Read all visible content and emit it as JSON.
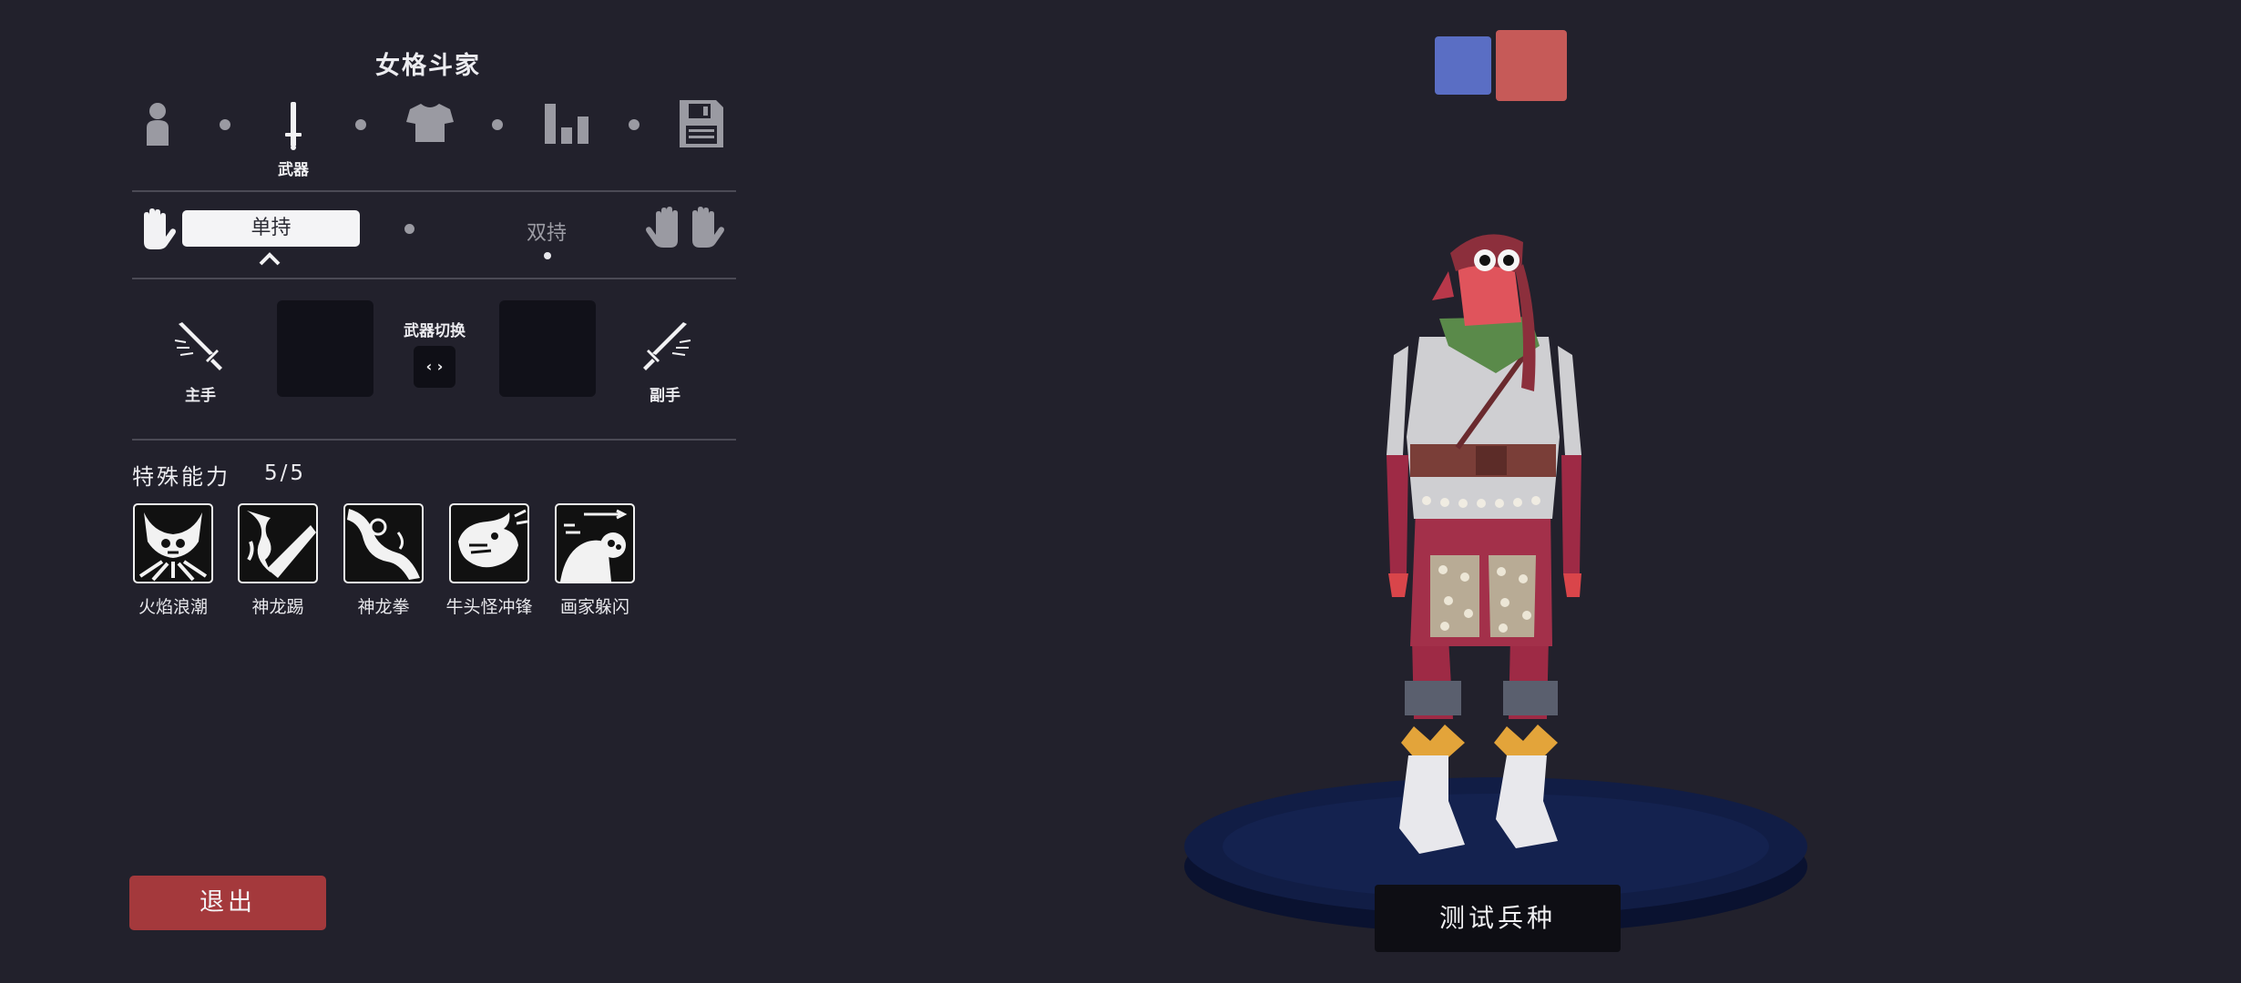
{
  "header": {
    "title": "女格斗家"
  },
  "steps": [
    {
      "name": "unit-base",
      "icon": "person-icon",
      "label": ""
    },
    {
      "name": "weapon",
      "icon": "sword-icon",
      "label": "武器"
    },
    {
      "name": "clothing",
      "icon": "shirt-icon",
      "label": ""
    },
    {
      "name": "stats",
      "icon": "bar-chart-icon",
      "label": ""
    },
    {
      "name": "save",
      "icon": "floppy-disk-icon",
      "label": ""
    }
  ],
  "grip": {
    "single": "单持",
    "dual": "双持",
    "selected": "单持"
  },
  "weapons": {
    "main_hand": "主手",
    "off_hand": "副手",
    "switch_label": "武器切换",
    "switch_glyph": "‹ ›"
  },
  "abilities": {
    "title": "特殊能力",
    "count": "5/5",
    "items": [
      {
        "label": "火焰浪潮",
        "icon": "fire-wave-icon"
      },
      {
        "label": "神龙踢",
        "icon": "dragon-kick-icon"
      },
      {
        "label": "神龙拳",
        "icon": "dragon-punch-icon"
      },
      {
        "label": "牛头怪冲锋",
        "icon": "minotaur-charge-icon"
      },
      {
        "label": "画家躲闪",
        "icon": "painter-dodge-icon"
      }
    ]
  },
  "actions": {
    "exit": "退出",
    "test_unit": "测试兵种"
  },
  "team_colors": {
    "blue": "#5a6ec4",
    "red": "#c65a58",
    "selected": "red"
  },
  "colors": {
    "background": "#22212c",
    "exit_button": "#a4393c",
    "platform": "#0f1a3a"
  }
}
